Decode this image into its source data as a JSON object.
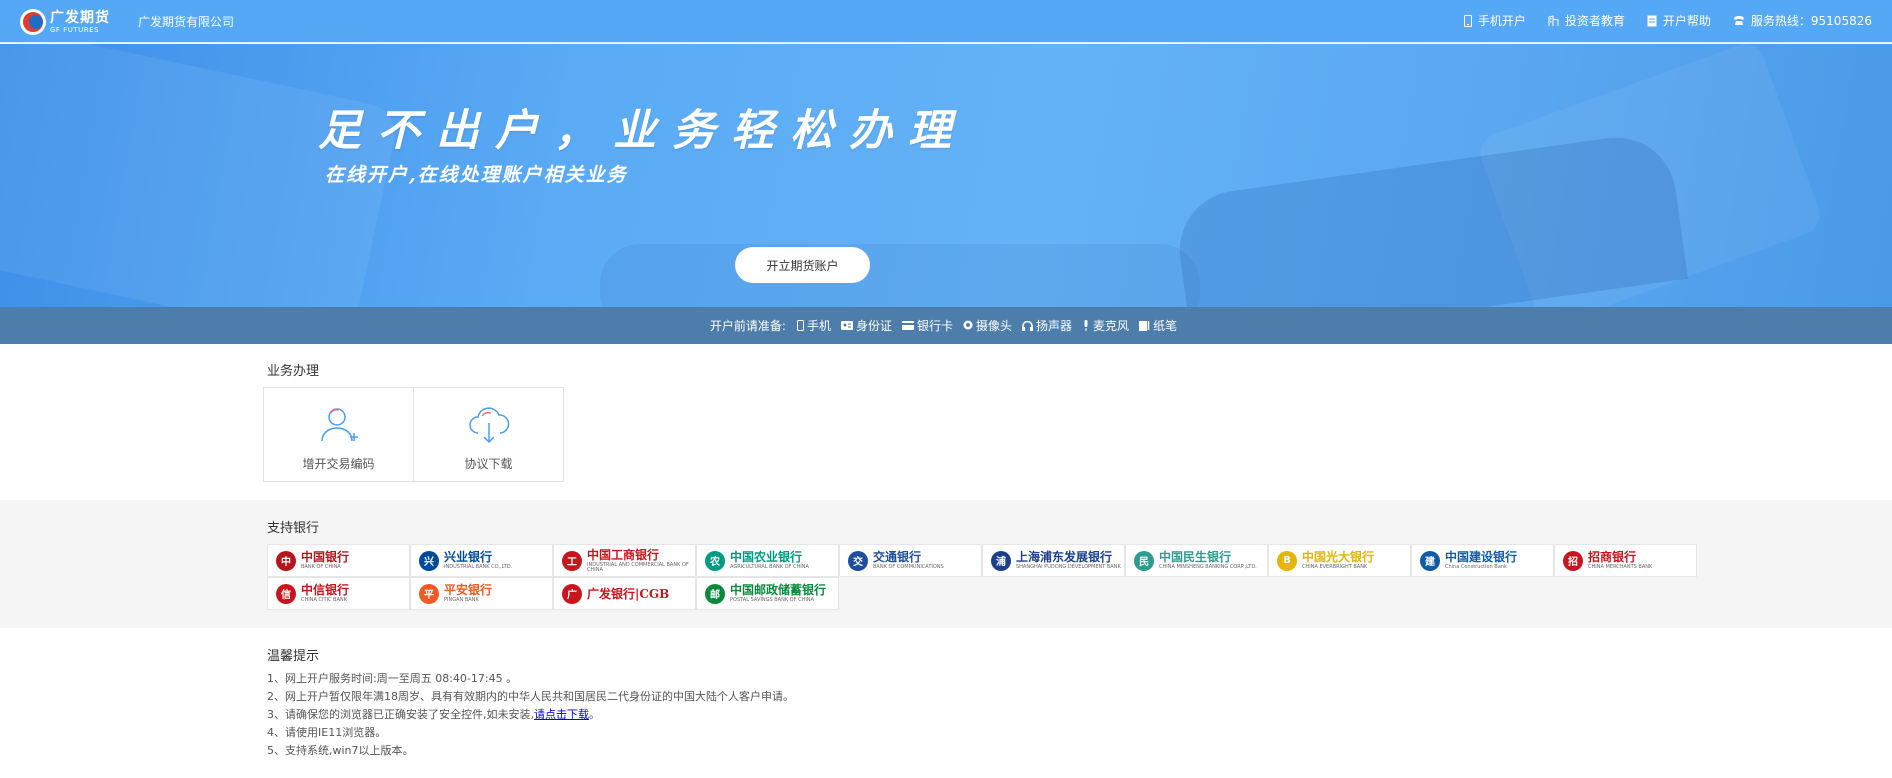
{
  "header": {
    "logo_cn": "广发期货",
    "logo_en": "GF FUTURES",
    "company": "广发期货有限公司",
    "nav": [
      {
        "icon": "phone-icon",
        "label": "手机开户"
      },
      {
        "icon": "building-icon",
        "label": "投资者教育"
      },
      {
        "icon": "document-icon",
        "label": "开户帮助"
      },
      {
        "icon": "telephone-icon",
        "label": "服务热线：95105826"
      }
    ]
  },
  "banner": {
    "slogan": "足不出户，业务轻松办理",
    "subslogan": "在线开户,在线处理账户相关业务",
    "button": "开立期货账户",
    "prep_label": "开户前请准备:",
    "prep_items": [
      {
        "icon": "phone-icon",
        "label": "手机"
      },
      {
        "icon": "id-card-icon",
        "label": "身份证"
      },
      {
        "icon": "bank-card-icon",
        "label": "银行卡"
      },
      {
        "icon": "camera-icon",
        "label": "摄像头"
      },
      {
        "icon": "headphones-icon",
        "label": "扬声器"
      },
      {
        "icon": "microphone-icon",
        "label": "麦克风"
      },
      {
        "icon": "notebook-icon",
        "label": "纸笔"
      }
    ]
  },
  "services": {
    "title": "业务办理",
    "items": [
      {
        "icon": "user-add-icon",
        "label": "增开交易编码"
      },
      {
        "icon": "cloud-download-icon",
        "label": "协议下载"
      }
    ]
  },
  "banks": {
    "title": "支持银行",
    "items": [
      {
        "cn": "中国银行",
        "en": "BANK OF CHINA",
        "color": "#b5161c",
        "glyph": "中"
      },
      {
        "cn": "兴业银行",
        "en": "INDUSTRIAL BANK CO.,LTD.",
        "color": "#004b9b",
        "glyph": "兴"
      },
      {
        "cn": "中国工商银行",
        "en": "INDUSTRIAL AND COMMERCIAL BANK OF CHINA",
        "color": "#c4161c",
        "glyph": "工"
      },
      {
        "cn": "中国农业银行",
        "en": "AGRICULTURAL BANK OF CHINA",
        "color": "#009a83",
        "glyph": "农"
      },
      {
        "cn": "交通银行",
        "en": "BANK OF COMMUNICATIONS",
        "color": "#1d4f9c",
        "glyph": "交"
      },
      {
        "cn": "上海浦东发展银行",
        "en": "SHANGHAI PUDONG DEVELOPMENT BANK",
        "color": "#1b3f8c",
        "glyph": "浦"
      },
      {
        "cn": "中国民生银行",
        "en": "CHINA MINSHENG BANKING CORP.,LTD.",
        "color": "#2f9a8e",
        "glyph": "民"
      },
      {
        "cn": "中国光大银行",
        "en": "CHINA EVERBRIGHT BANK",
        "color": "#e3b600",
        "glyph": "B"
      },
      {
        "cn": "中国建设银行",
        "en": "China Construction Bank",
        "color": "#0f5ba8",
        "glyph": "建"
      },
      {
        "cn": "招商银行",
        "en": "CHINA MERCHANTS BANK",
        "color": "#c8161e",
        "glyph": "招"
      },
      {
        "cn": "中信银行",
        "en": "CHINA CITIC BANK",
        "color": "#c8161e",
        "glyph": "信"
      },
      {
        "cn": "平安银行",
        "en": "PINGAN BANK",
        "color": "#f15a22",
        "glyph": "平"
      },
      {
        "cn": "广发银行|CGB",
        "en": "",
        "color": "#c8161e",
        "glyph": "广"
      },
      {
        "cn": "中国邮政储蓄银行",
        "en": "POSTAL SAVINGS BANK OF CHINA",
        "color": "#0b8a3e",
        "glyph": "邮"
      }
    ]
  },
  "tips": {
    "title": "温馨提示",
    "items": [
      "1、网上开户服务时间:周一至周五 08:40-17:45 。",
      "2、网上开户暂仅限年满18周岁、具有有效期内的中华人民共和国居民二代身份证的中国大陆个人客户申请。",
      "3、请确保您的浏览器已正确安装了安全控件,如未安装,",
      "4、请使用IE11浏览器。",
      "5、支持系统,win7以上版本。"
    ],
    "download_link": "请点击下载",
    "download_suffix": "。"
  }
}
